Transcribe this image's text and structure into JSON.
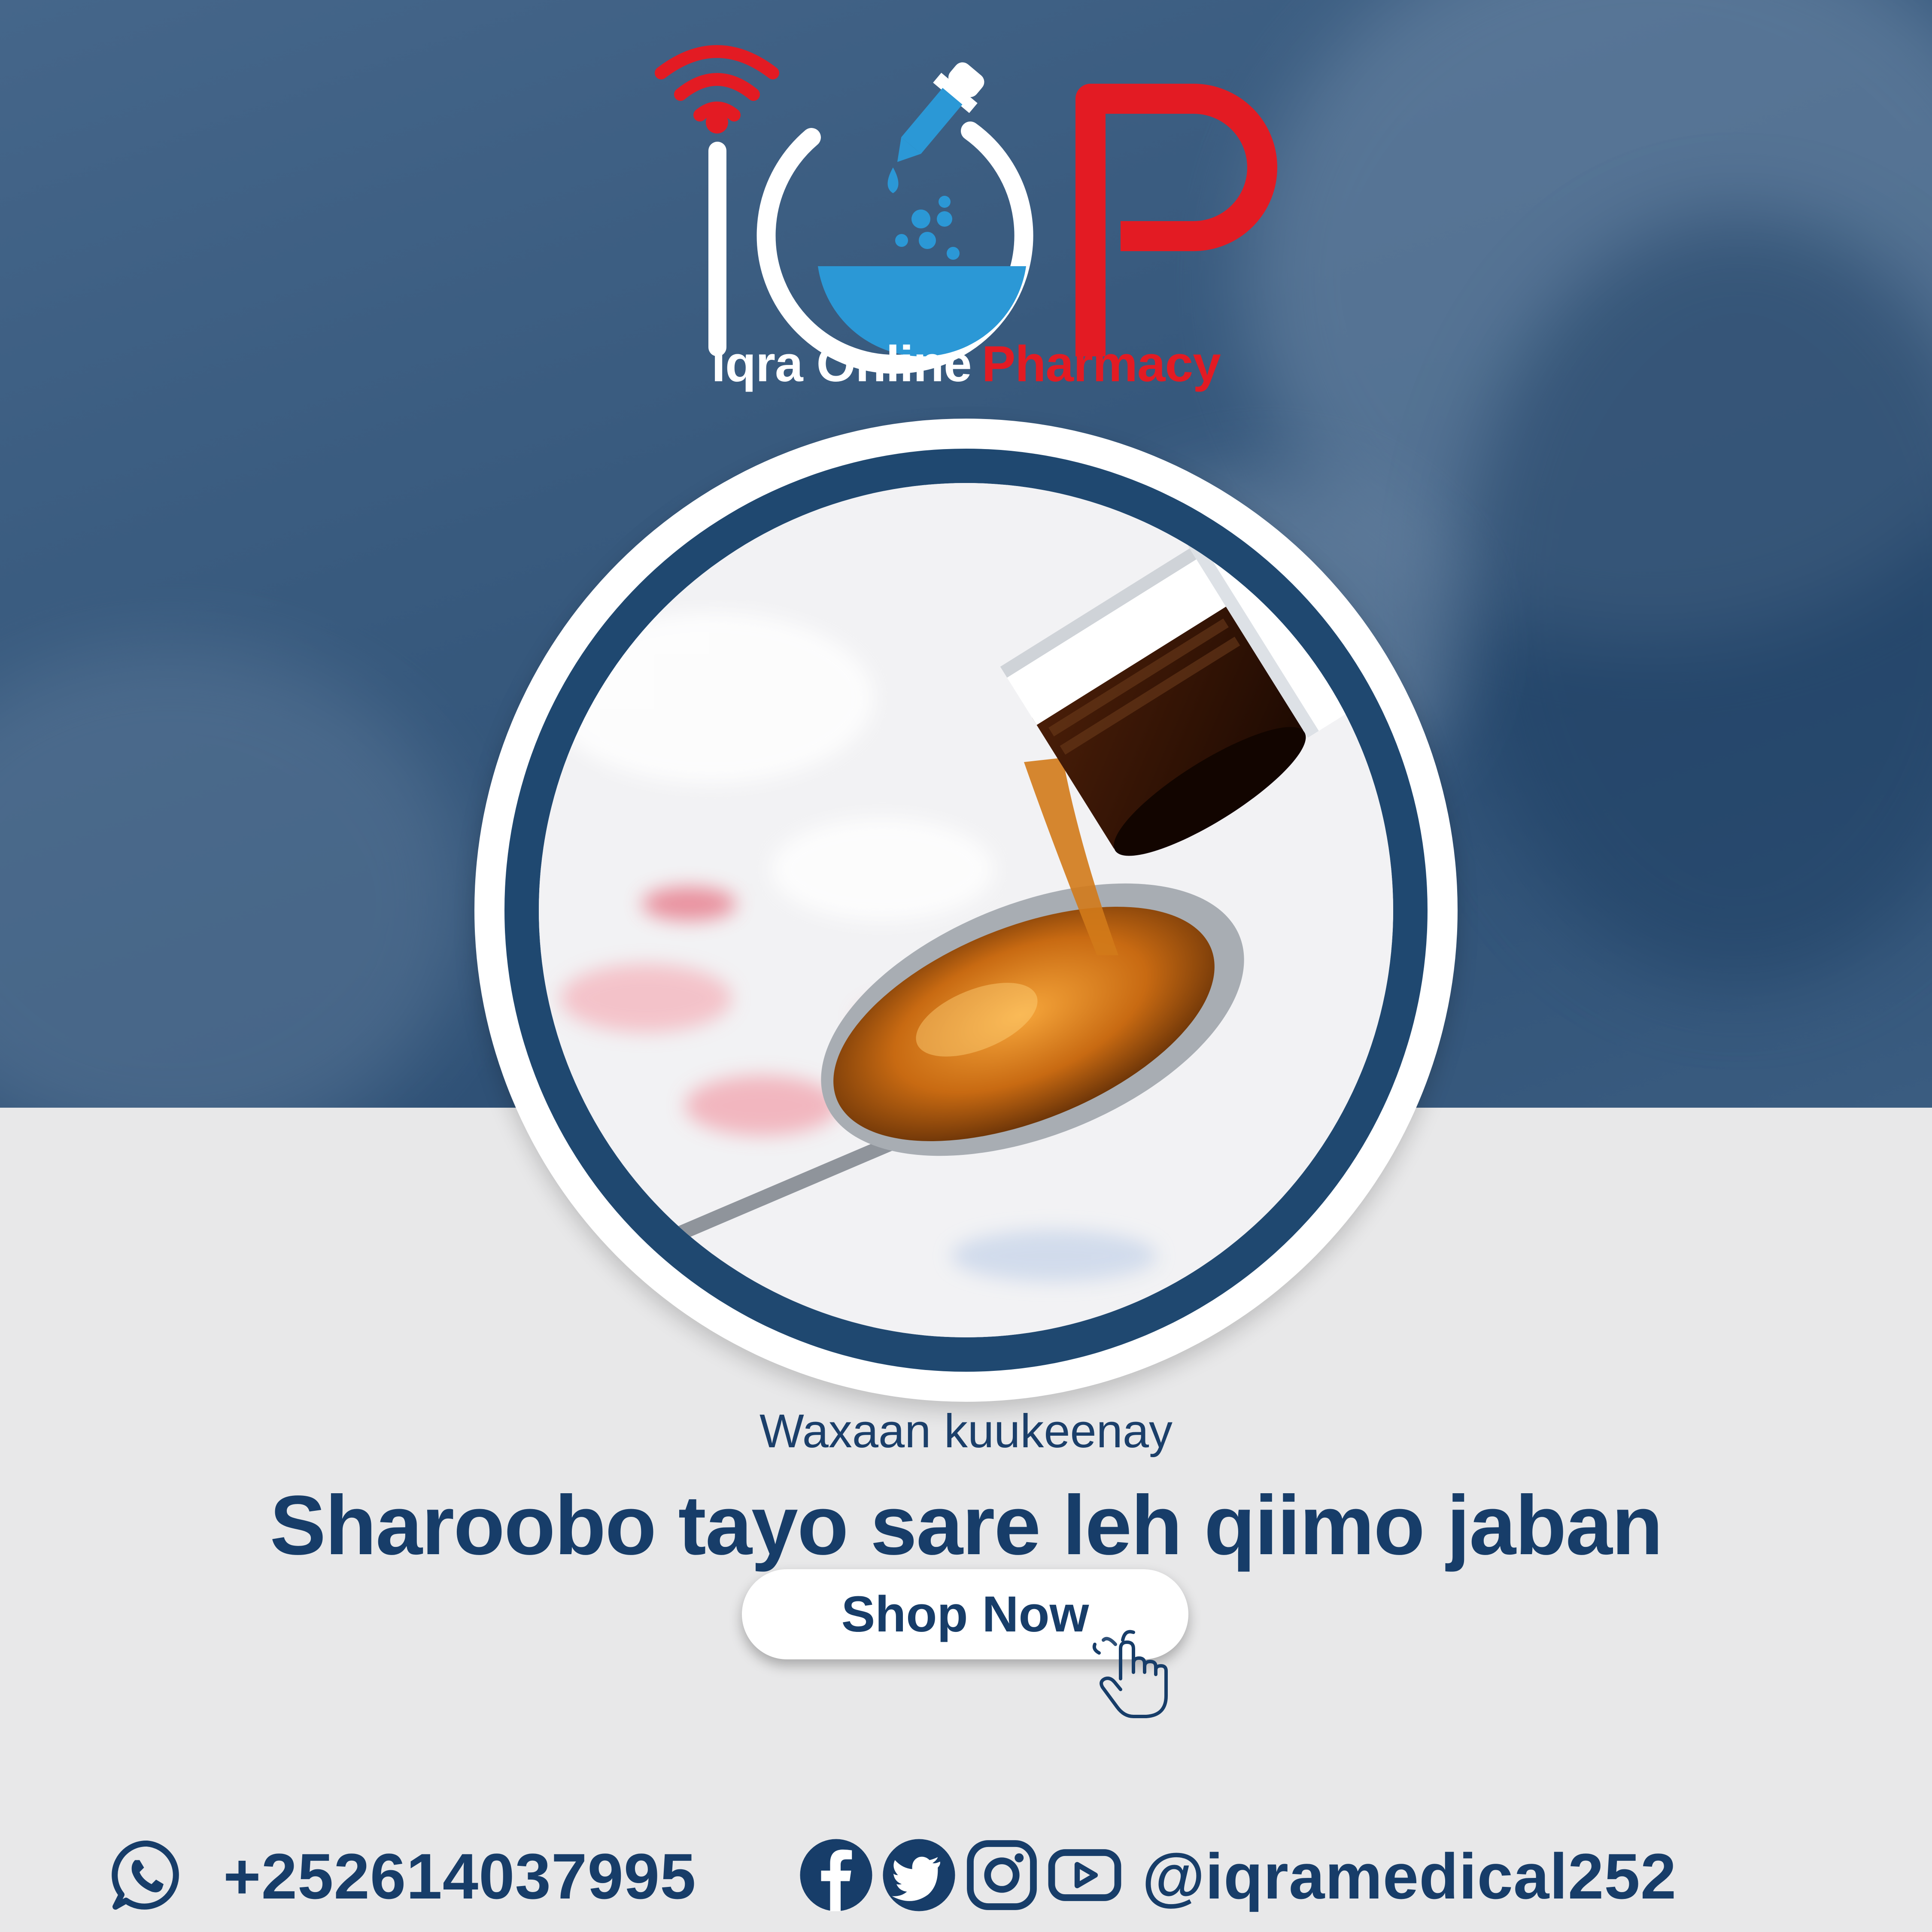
{
  "brand": {
    "name_part1": "Iqra Online",
    "name_part2": "Pharmacy",
    "logo_letters": "IQP",
    "colors": {
      "red": "#e31b23",
      "white": "#ffffff",
      "blue": "#2b98d6",
      "navy": "#173d69"
    }
  },
  "promo": {
    "subtitle": "Waxaan kuukeenay",
    "headline": "Sharoobo tayo sare leh qiimo jaban",
    "cta_label": "Shop Now"
  },
  "contact": {
    "phone": "+252614037995",
    "handle": "@iqramedical252",
    "icons": [
      "whatsapp-icon",
      "facebook-icon",
      "twitter-icon",
      "instagram-icon",
      "youtube-icon"
    ]
  }
}
